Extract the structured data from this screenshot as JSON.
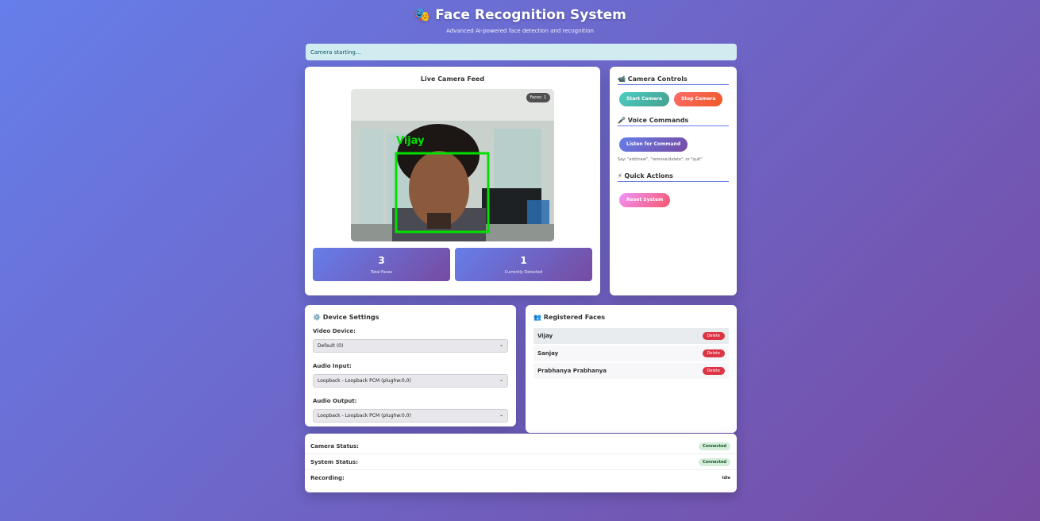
{
  "header": {
    "icon": "🎭",
    "title": "Face Recognition System",
    "subtitle": "Advanced AI-powered face detection and recognition"
  },
  "status_message": "Camera starting...",
  "camera_feed": {
    "title": "Live Camera Feed",
    "faces_badge": "Faces: 1",
    "detected_label": "Vijay",
    "stats": [
      {
        "value": "3",
        "label": "Total Faces"
      },
      {
        "value": "1",
        "label": "Currently Detected"
      }
    ]
  },
  "controls": {
    "camera_section": "📹 Camera Controls",
    "start_label": "Start Camera",
    "stop_label": "Stop Camera",
    "voice_section": "🎤 Voice Commands",
    "listen_label": "Listen for Command",
    "voice_hint": "Say: \"add/new\", \"remove/delete\", or \"quit\"",
    "quick_section": "⚡ Quick Actions",
    "reset_label": "Reset System"
  },
  "device_settings": {
    "title": "⚙️ Device Settings",
    "video_label": "Video Device:",
    "video_value": "Default (0)",
    "audio_input_label": "Audio Input:",
    "audio_input_value": "Loopback - Loopback PCM (plughw:0,0)",
    "audio_output_label": "Audio Output:",
    "audio_output_value": "Loopback - Loopback PCM (plughw:0,0)"
  },
  "registered_faces": {
    "title": "👥 Registered Faces",
    "delete_label": "Delete",
    "items": [
      {
        "name": "Vijay"
      },
      {
        "name": "Sanjay"
      },
      {
        "name": "Prabhanya Prabhanya"
      }
    ]
  },
  "system_stats": {
    "camera_status_label": "Camera Status:",
    "camera_status_value": "Connected",
    "system_status_label": "System Status:",
    "system_status_value": "Connected",
    "recording_label": "Recording:",
    "recording_value": "Idle"
  },
  "colors": {
    "gradient_start": "#667eea",
    "gradient_end": "#764ba2",
    "detection_box": "#00ff00",
    "delete": "#dc3545"
  }
}
